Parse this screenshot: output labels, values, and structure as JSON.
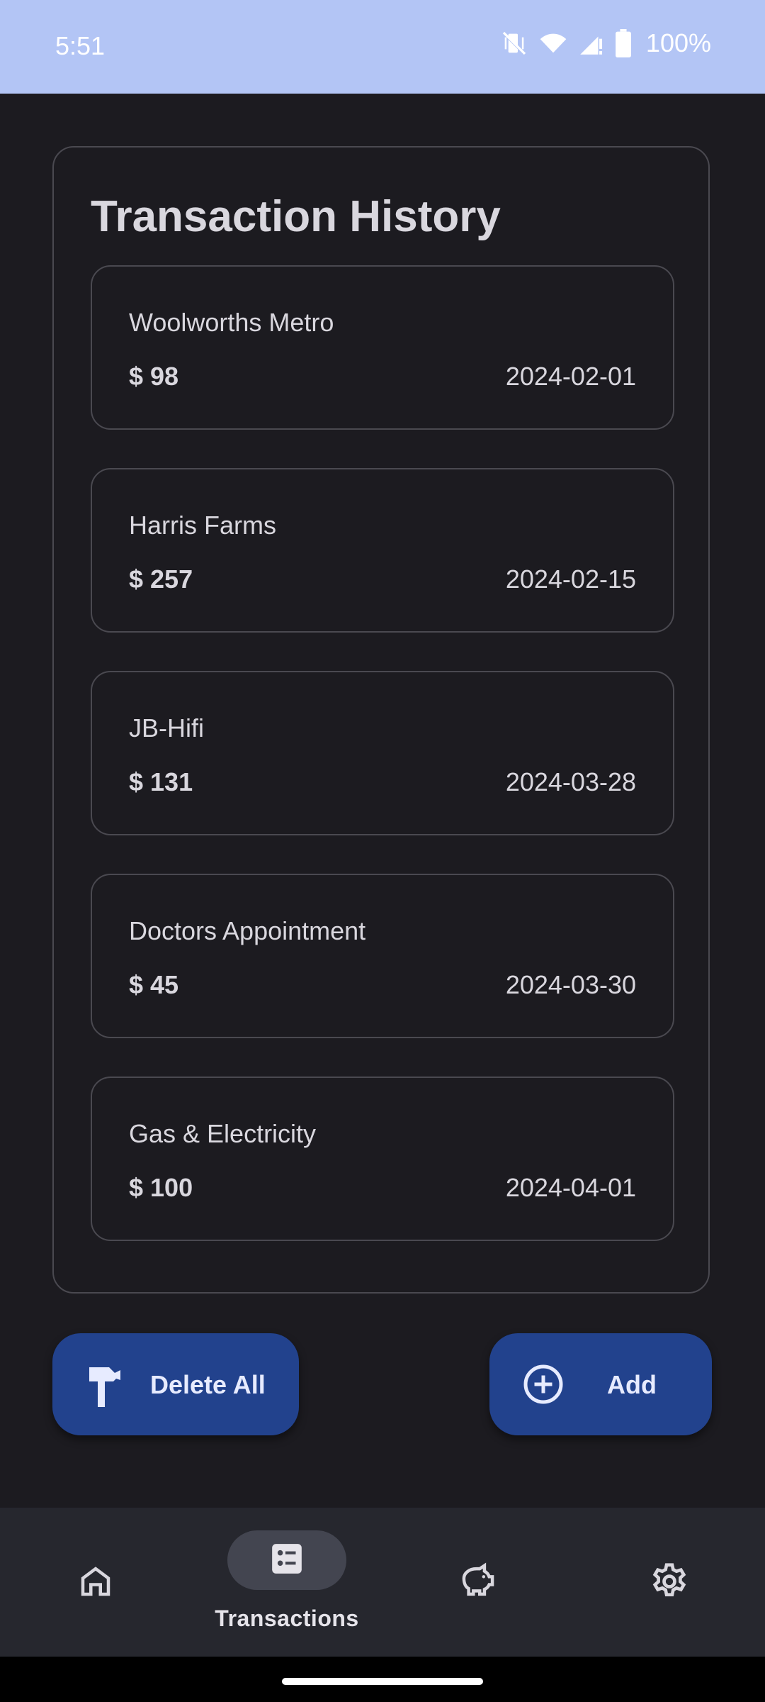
{
  "status_bar": {
    "time": "5:51",
    "battery": "100%",
    "icons": [
      "vibrate-off-icon",
      "wifi-icon",
      "signal-icon",
      "battery-icon"
    ]
  },
  "history": {
    "title": "Transaction History",
    "transactions": [
      {
        "name": "Woolworths Metro",
        "amount": "$ 98",
        "date": "2024-02-01"
      },
      {
        "name": "Harris Farms",
        "amount": "$ 257",
        "date": "2024-02-15"
      },
      {
        "name": "JB-Hifi",
        "amount": "$ 131",
        "date": "2024-03-28"
      },
      {
        "name": "Doctors Appointment",
        "amount": "$ 45",
        "date": "2024-03-30"
      },
      {
        "name": "Gas & Electricity",
        "amount": "$ 100",
        "date": "2024-04-01"
      }
    ]
  },
  "actions": {
    "delete_all_label": "Delete All",
    "delete_all_icon": "hammer-icon",
    "add_label": "Add",
    "add_icon": "add-circle-icon"
  },
  "bottom_nav": {
    "items": [
      {
        "label": "",
        "icon": "home-icon"
      },
      {
        "label": "Transactions",
        "icon": "list-icon",
        "active": true
      },
      {
        "label": "",
        "icon": "piggy-bank-icon"
      },
      {
        "label": "",
        "icon": "settings-icon"
      }
    ]
  },
  "colors": {
    "background": "#1c1b20",
    "status_bar": "#b3c5f5",
    "button": "#22428d",
    "nav_bar": "#26272e",
    "active_pill": "#434550"
  }
}
